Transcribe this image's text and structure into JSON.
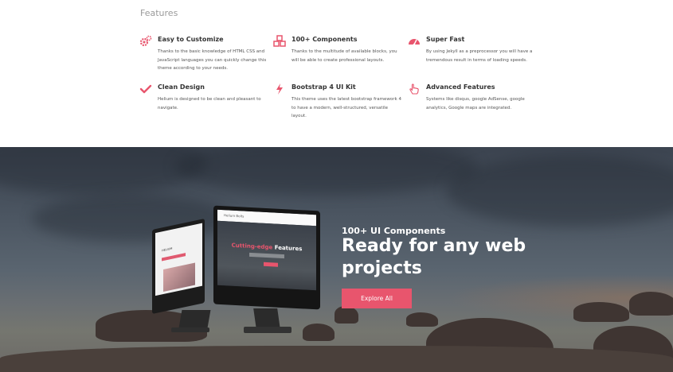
{
  "features_section": {
    "title": "Features",
    "items": [
      {
        "icon": "gears-icon",
        "title": "Easy to Customize",
        "description": "Thanks to the basic knowledge of HTML CSS and JavaScript languages you can quickly change this theme according to your needs."
      },
      {
        "icon": "cubes-icon",
        "title": "100+ Components",
        "description": "Thanks to the multitude of available blocks, you will be able to create professional layouts."
      },
      {
        "icon": "tachometer-icon",
        "title": "Super Fast",
        "description": "By using Jekyll as a preprocessor you will have a tremendous result in terms of loading speeds."
      },
      {
        "icon": "checkmark-icon",
        "title": "Clean Design",
        "description": "Helium is designed to be clean and pleasant to navigate."
      },
      {
        "icon": "lightning-icon",
        "title": "Bootstrap 4 UI Kit",
        "description": "This theme uses the latest bootstrap framework 4 to have a modern, well-structured, versatile layout."
      },
      {
        "icon": "hand-pointer-icon",
        "title": "Advanced Features",
        "description": "Systems like disqus, google AdSense, google analytics, Google maps are integrated."
      }
    ],
    "accent_color": "#e8556d"
  },
  "hero": {
    "kicker": "100+ UI Components",
    "headline": "Ready for any web projects",
    "button_label": "Explore All",
    "mockup": {
      "big_screen_brand": "Helium Bolts",
      "big_screen_headline_accent": "Cutting-edge",
      "big_screen_headline_rest": "Features",
      "small_screen_brand": "HELIUM"
    }
  }
}
